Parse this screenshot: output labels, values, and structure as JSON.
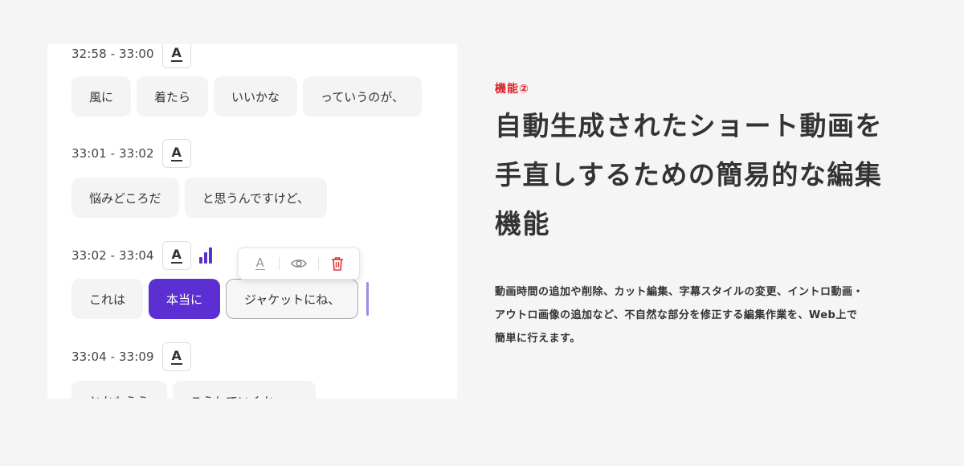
{
  "editor": {
    "segments": [
      {
        "time": "32:58 - 33:00",
        "style_icon": "A",
        "words": [
          "風に",
          "着たら",
          "いいかな",
          "っていうのが、"
        ]
      },
      {
        "time": "33:01 - 33:02",
        "style_icon": "A",
        "words": [
          "悩みどころだ",
          "と思うんですけど、"
        ]
      },
      {
        "time": "33:02 - 33:04",
        "style_icon": "A",
        "words": [
          "これは",
          "本当に",
          "ジャケットにね、"
        ],
        "selected_word": "本当に",
        "editing_word": "ジャケットにね、"
      },
      {
        "time": "33:04 - 33:09",
        "style_icon": "A",
        "words": [
          "とかもうう",
          "こうしていくか、…"
        ]
      }
    ],
    "toolbar": {
      "style_glyph": "A",
      "icons": [
        "text-style-icon",
        "eye-icon",
        "trash-icon"
      ]
    },
    "colors": {
      "accent": "#5b2fd1",
      "delete": "#d9333a",
      "chip": "#f4f4f4"
    }
  },
  "info": {
    "tag": "機能②",
    "headline_lines": [
      "自動生成されたショート動画を",
      "手直しするための簡易的な編集",
      "機能"
    ],
    "description_lines": [
      "動画時間の追加や削除、カット編集、字幕スタイルの変更、イントロ動画・",
      "アウトロ画像の追加など、不自然な部分を修正する編集作業を、Web上で",
      "簡単に行えます。"
    ],
    "colors": {
      "tag": "#e0202a",
      "text": "#333333"
    }
  }
}
